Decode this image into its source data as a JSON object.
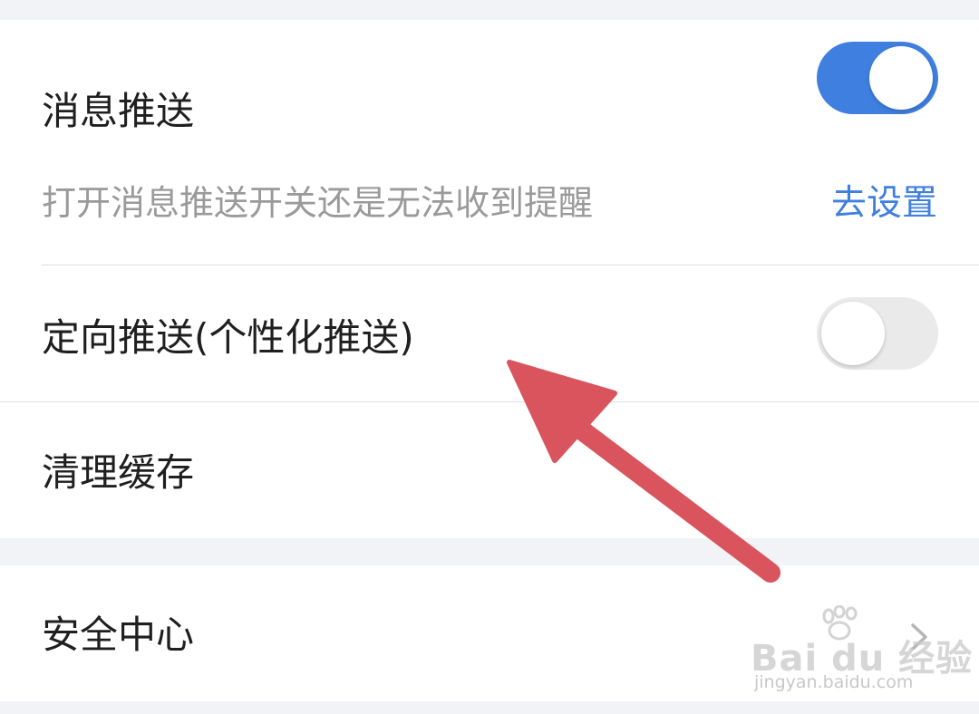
{
  "settings": {
    "message_push": {
      "label": "消息推送",
      "toggle_on": true
    },
    "push_hint": {
      "text": "打开消息推送开关还是无法收到提醒",
      "link": "去设置"
    },
    "targeted_push": {
      "label": "定向推送(个性化推送)",
      "toggle_on": false
    },
    "clear_cache": {
      "label": "清理缓存"
    },
    "security_center": {
      "label": "安全中心",
      "icon": "chevron-right-icon"
    }
  },
  "colors": {
    "accent": "#3f7fe0",
    "toggle_off": "#eaeaea",
    "annotation_arrow": "#d9545c",
    "background": "#f2f3f7"
  },
  "watermark": {
    "brand": "Bai du 经验",
    "url": "jingyan.baidu.com"
  }
}
